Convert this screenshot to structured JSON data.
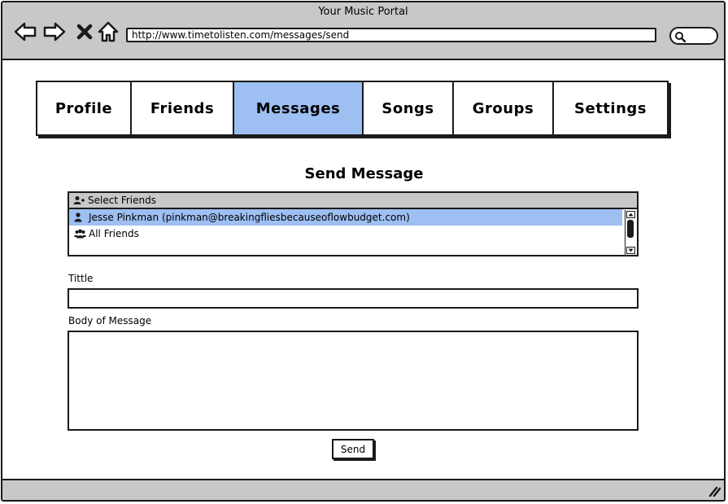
{
  "window": {
    "title": "Your Music Portal",
    "url": "http://www.timetolisten.com/messages/send"
  },
  "nav": {
    "back_icon": "arrow-left-icon",
    "forward_icon": "arrow-right-icon",
    "close_icon": "close-icon",
    "home_icon": "home-icon",
    "search_icon": "search-icon"
  },
  "tabs": [
    {
      "label": "Profile",
      "active": false
    },
    {
      "label": "Friends",
      "active": false
    },
    {
      "label": "Messages",
      "active": true
    },
    {
      "label": "Songs",
      "active": false
    },
    {
      "label": "Groups",
      "active": false
    },
    {
      "label": "Settings",
      "active": false
    }
  ],
  "form": {
    "heading": "Send Message",
    "recipients": {
      "header": "Select Friends",
      "items": [
        {
          "label": "Jesse Pinkman (pinkman@breakingfliesbecauseoflowbudget.com)",
          "selected": true
        },
        {
          "label": "All Friends",
          "selected": false
        }
      ]
    },
    "title_label": "Tittle",
    "title_value": "",
    "body_label": "Body of Message",
    "body_value": "",
    "send_label": "Send"
  },
  "colors": {
    "accent": "#9dbff2",
    "chrome": "#c8c8c8",
    "outline": "#1a1a1a"
  }
}
